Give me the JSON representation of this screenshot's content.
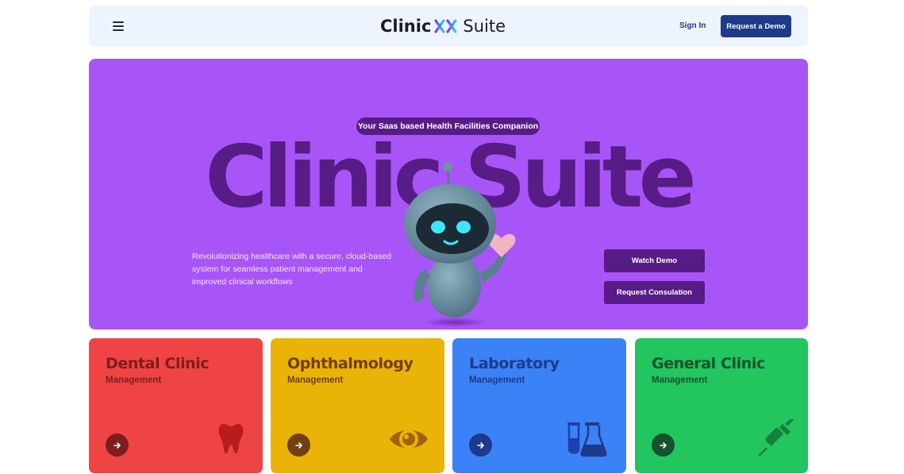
{
  "header": {
    "brand_left": "Clinic",
    "brand_right": "Suite",
    "sign_in": "Sign In",
    "request_demo": "Request a Demo"
  },
  "hero": {
    "tagline": "Your Saas based Health Facilities Companion",
    "title": "Clinic Suite",
    "description": "Revolutionizing healthcare with a secure, cloud-based system for seamless patient management and improved clinical workflows",
    "watch_demo": "Watch Demo",
    "request_consultation": "Request Consulation"
  },
  "cards": [
    {
      "title": "Dental Clinic",
      "subtitle": "Management",
      "icon": "tooth-icon"
    },
    {
      "title": "Ophthalmology",
      "subtitle": "Management",
      "icon": "eye-icon"
    },
    {
      "title": "Laboratory",
      "subtitle": "Management",
      "icon": "lab-flask-icon"
    },
    {
      "title": "General Clinic",
      "subtitle": "Management",
      "icon": "syringe-icon"
    }
  ],
  "colors": {
    "navy": "#1e3a8a",
    "hero_purple": "#a855f7",
    "hero_dark_purple": "#581c87",
    "dental_red": "#ef4444",
    "ophthalmology_yellow": "#eab308",
    "laboratory_blue": "#3b82f6",
    "general_green": "#22c55e"
  }
}
